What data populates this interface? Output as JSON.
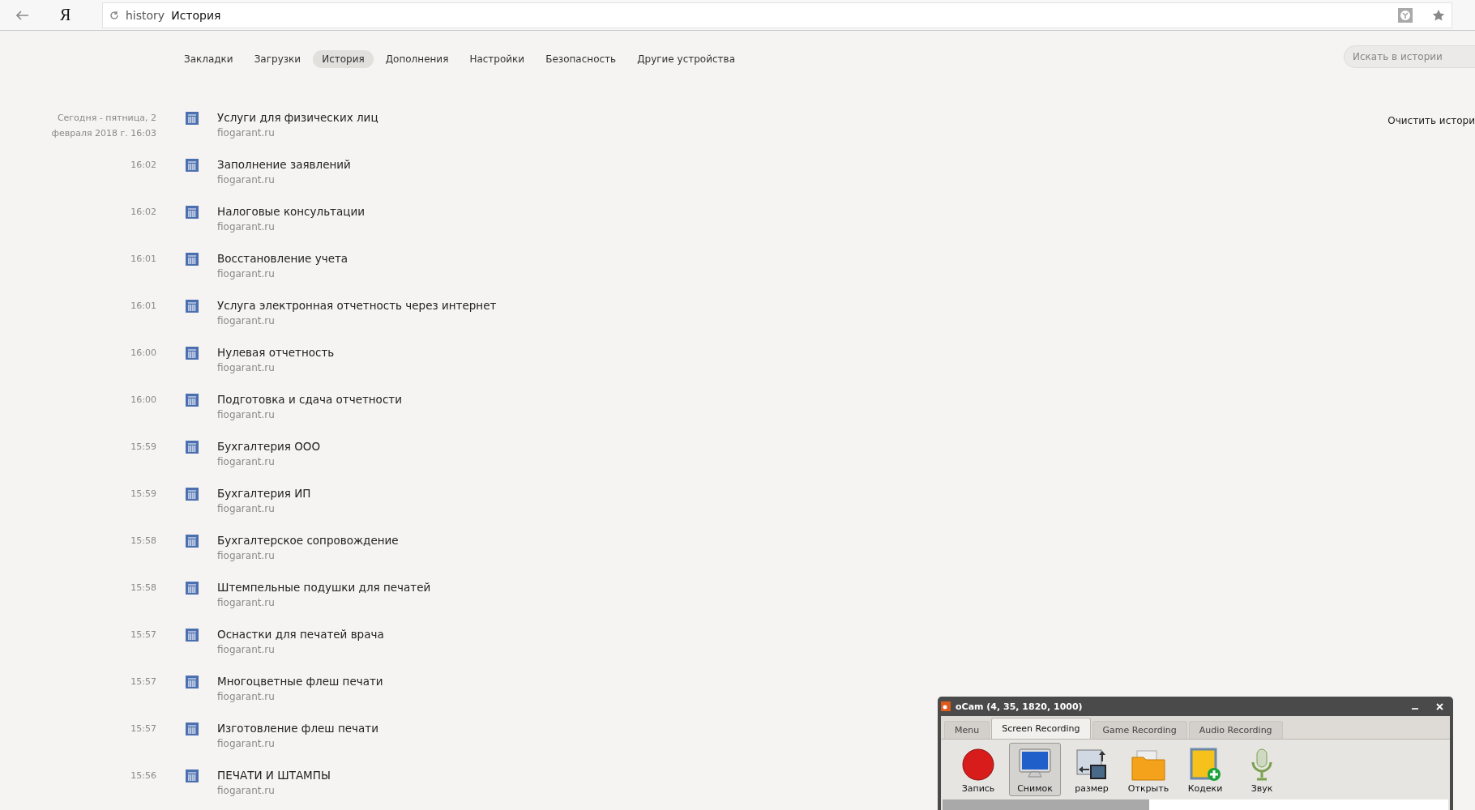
{
  "browser": {
    "logo": "Я",
    "address_prefix": "history",
    "address_title": "История"
  },
  "nav": [
    {
      "label": "Закладки",
      "selected": false
    },
    {
      "label": "Загрузки",
      "selected": false
    },
    {
      "label": "История",
      "selected": true
    },
    {
      "label": "Дополнения",
      "selected": false
    },
    {
      "label": "Настройки",
      "selected": false
    },
    {
      "label": "Безопасность",
      "selected": false
    },
    {
      "label": "Другие устройства",
      "selected": false
    }
  ],
  "search": {
    "placeholder": "Искать в истории"
  },
  "clear_history": "Очистить истори",
  "history": [
    {
      "time": "Сегодня - пятница, 2 февраля 2018 г. 16:03",
      "title": "Услуги для физических лиц",
      "domain": "fiogarant.ru"
    },
    {
      "time": "16:02",
      "title": "Заполнение заявлений",
      "domain": "fiogarant.ru"
    },
    {
      "time": "16:02",
      "title": "Налоговые консультации",
      "domain": "fiogarant.ru"
    },
    {
      "time": "16:01",
      "title": "Восстановление учета",
      "domain": "fiogarant.ru"
    },
    {
      "time": "16:01",
      "title": "Услуга электронная отчетность через интернет",
      "domain": "fiogarant.ru"
    },
    {
      "time": "16:00",
      "title": "Нулевая отчетность",
      "domain": "fiogarant.ru"
    },
    {
      "time": "16:00",
      "title": "Подготовка и сдача отчетности",
      "domain": "fiogarant.ru"
    },
    {
      "time": "15:59",
      "title": "Бухгалтерия ООО",
      "domain": "fiogarant.ru"
    },
    {
      "time": "15:59",
      "title": "Бухгалтерия ИП",
      "domain": "fiogarant.ru"
    },
    {
      "time": "15:58",
      "title": "Бухгалтерское сопровождение",
      "domain": "fiogarant.ru"
    },
    {
      "time": "15:58",
      "title": "Штемпельные подушки для печатей",
      "domain": "fiogarant.ru"
    },
    {
      "time": "15:57",
      "title": "Оснастки для печатей врача",
      "domain": "fiogarant.ru"
    },
    {
      "time": "15:57",
      "title": "Многоцветные флеш печати",
      "domain": "fiogarant.ru"
    },
    {
      "time": "15:57",
      "title": "Изготовление флеш печати",
      "domain": "fiogarant.ru"
    },
    {
      "time": "15:56",
      "title": "ПЕЧАТИ И ШТАМПЫ",
      "domain": "fiogarant.ru"
    }
  ],
  "ocam": {
    "title": "oCam (4, 35, 1820, 1000)",
    "tabs": [
      {
        "label": "Menu",
        "selected": false
      },
      {
        "label": "Screen Recording",
        "selected": true
      },
      {
        "label": "Game Recording",
        "selected": false
      },
      {
        "label": "Audio Recording",
        "selected": false
      }
    ],
    "tools": [
      {
        "kind": "record",
        "label": "Запись",
        "selected": false
      },
      {
        "kind": "snapshot",
        "label": "Снимок",
        "selected": true
      },
      {
        "kind": "resize",
        "label": "размер",
        "selected": false
      },
      {
        "kind": "open",
        "label": "Открыть",
        "selected": false
      },
      {
        "kind": "codecs",
        "label": "Кодеки",
        "selected": false
      },
      {
        "kind": "sound",
        "label": "Звук",
        "selected": false
      }
    ]
  }
}
